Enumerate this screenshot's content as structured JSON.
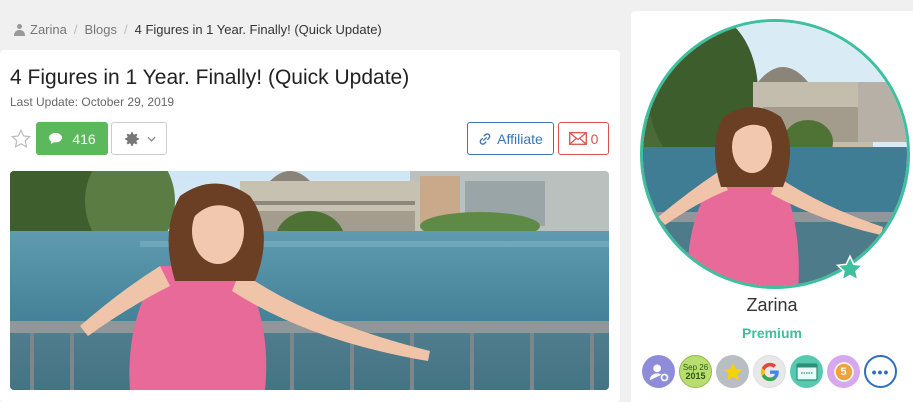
{
  "breadcrumb": {
    "user": "Zarina",
    "section": "Blogs",
    "current": "4 Figures in 1 Year. Finally! (Quick Update)",
    "separator": "/"
  },
  "post": {
    "title": "4 Figures in 1 Year. Finally! (Quick Update)",
    "last_update": "Last Update: October 29, 2019"
  },
  "toolbar": {
    "favorite_icon": "star-outline-icon",
    "comments_count": "416",
    "settings_icon": "gear-icon",
    "affiliate_label": "Affiliate",
    "mail_count": "0"
  },
  "profile": {
    "name": "Zarina",
    "status": "Premium",
    "badge_date_month": "Sep 26",
    "badge_date_year": "2015",
    "badge_number": "5"
  },
  "colors": {
    "green": "#5cb85c",
    "teal": "#3ebf9e",
    "affiliate_blue": "#3a75b4",
    "mail_red": "#d9534f"
  }
}
